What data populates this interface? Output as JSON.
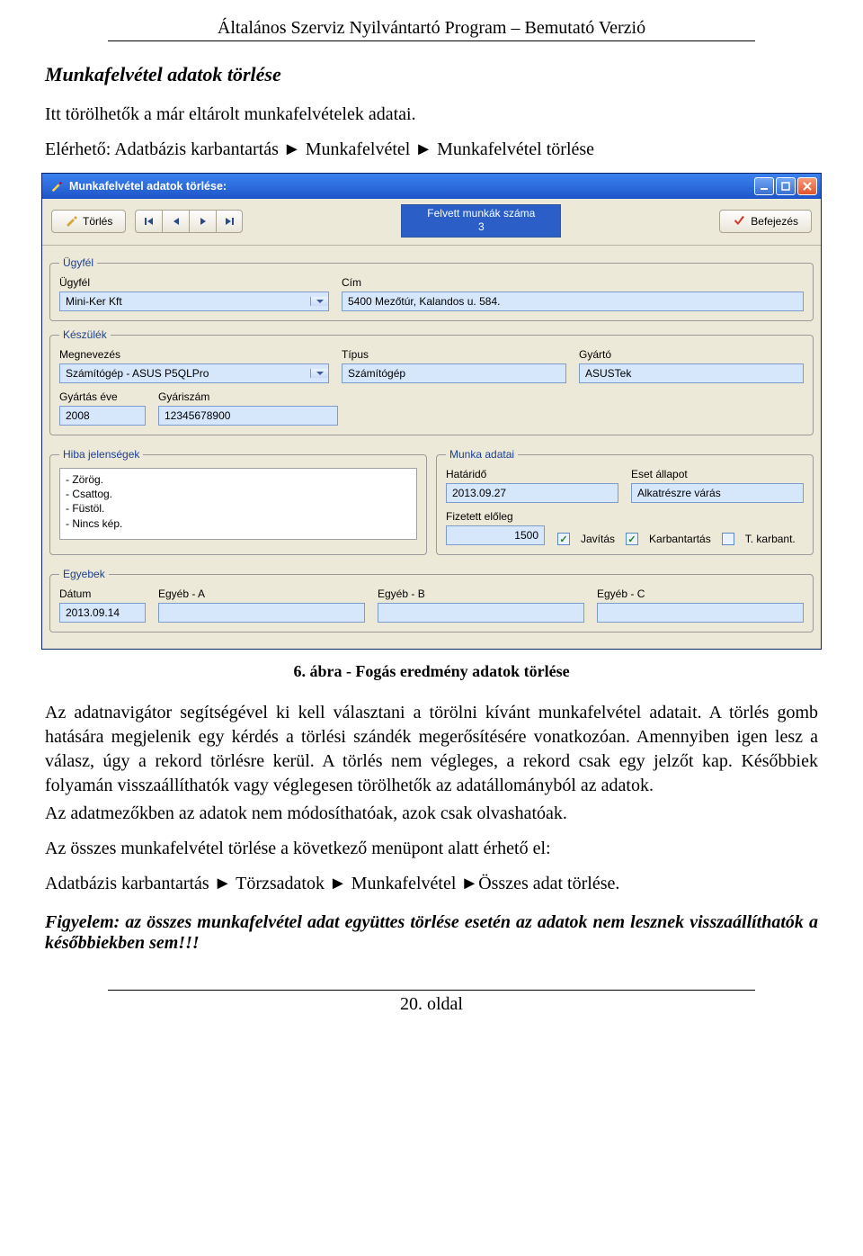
{
  "doc": {
    "header": "Általános Szerviz Nyilvántartó Program – Bemutató Verzió",
    "sectionTitle": "Munkafelvétel adatok törlése",
    "intro": "Itt törölhetők a már eltárolt munkafelvételek adatai.",
    "path": "Elérhető: Adatbázis karbantartás ► Munkafelvétel ► Munkafelvétel törlése",
    "caption": "6. ábra - Fogás eredmény adatok törlése",
    "para1": "Az adatnavigátor segítségével ki kell választani a törölni kívánt munkafelvétel adatait. A törlés gomb hatására megjelenik egy kérdés a törlési szándék megerősítésére vonatkozóan. Amennyiben igen lesz a válasz, úgy a rekord törlésre kerül. A törlés nem végleges, a rekord csak egy jelzőt kap. Későbbiek folyamán visszaállíthatók vagy véglegesen törölhetők az adatállományból az adatok.",
    "para1b": "Az adatmezőkben az adatok nem módosíthatóak, azok csak olvashatóak.",
    "para2": "Az összes munkafelvétel törlése a következő menüpont alatt érhető el:",
    "para3": "Adatbázis karbantartás ► Törzsadatok ► Munkafelvétel ►Összes adat törlése.",
    "warning": "Figyelem: az összes munkafelvétel adat együttes törlése esetén az adatok nem lesznek visszaállíthatók a későbbiekben sem!!!",
    "footer": "20. oldal"
  },
  "win": {
    "title": "Munkafelvétel adatok törlése:",
    "deleteLabel": "Törlés",
    "countLabel": "Felvett munkák száma",
    "countValue": "3",
    "finishLabel": "Befejezés",
    "groups": {
      "ugyfel": "Ügyfél",
      "keszulek": "Készülék",
      "hiba": "Hiba jelenségek",
      "munka": "Munka adatai",
      "egyebek": "Egyebek"
    },
    "labels": {
      "ugyfel": "Ügyfél",
      "cim": "Cím",
      "megnevezes": "Megnevezés",
      "tipus": "Típus",
      "gyarto": "Gyártó",
      "gyev": "Gyártás éve",
      "gyszam": "Gyáriszám",
      "hatarido": "Határidő",
      "eset": "Eset állapot",
      "eloleg": "Fizetett előleg",
      "datum": "Dátum",
      "egyA": "Egyéb - A",
      "egyB": "Egyéb - B",
      "egyC": "Egyéb - C",
      "chkJavitas": "Javítás",
      "chkKarb": "Karbantartás",
      "chkTkarb": "T. karbant."
    },
    "values": {
      "ugyfel": "Mini-Ker Kft",
      "cim": "5400 Mezőtúr, Kalandos u. 584.",
      "megnevezes": "Számítógép - ASUS P5QLPro",
      "tipus": "Számítógép",
      "gyarto": "ASUSTek",
      "gyev": "2008",
      "gyszam": "12345678900",
      "hatarido": "2013.09.27",
      "eset": "Alkatrészre várás",
      "eloleg": "1500",
      "datum": "2013.09.14",
      "egyA": "",
      "egyB": "",
      "egyC": ""
    },
    "hibaLines": [
      "- Zörög.",
      "- Csattog.",
      "- Füstöl.",
      "- Nincs kép."
    ],
    "chk": {
      "javitas": true,
      "karb": true,
      "tkarb": false
    }
  }
}
